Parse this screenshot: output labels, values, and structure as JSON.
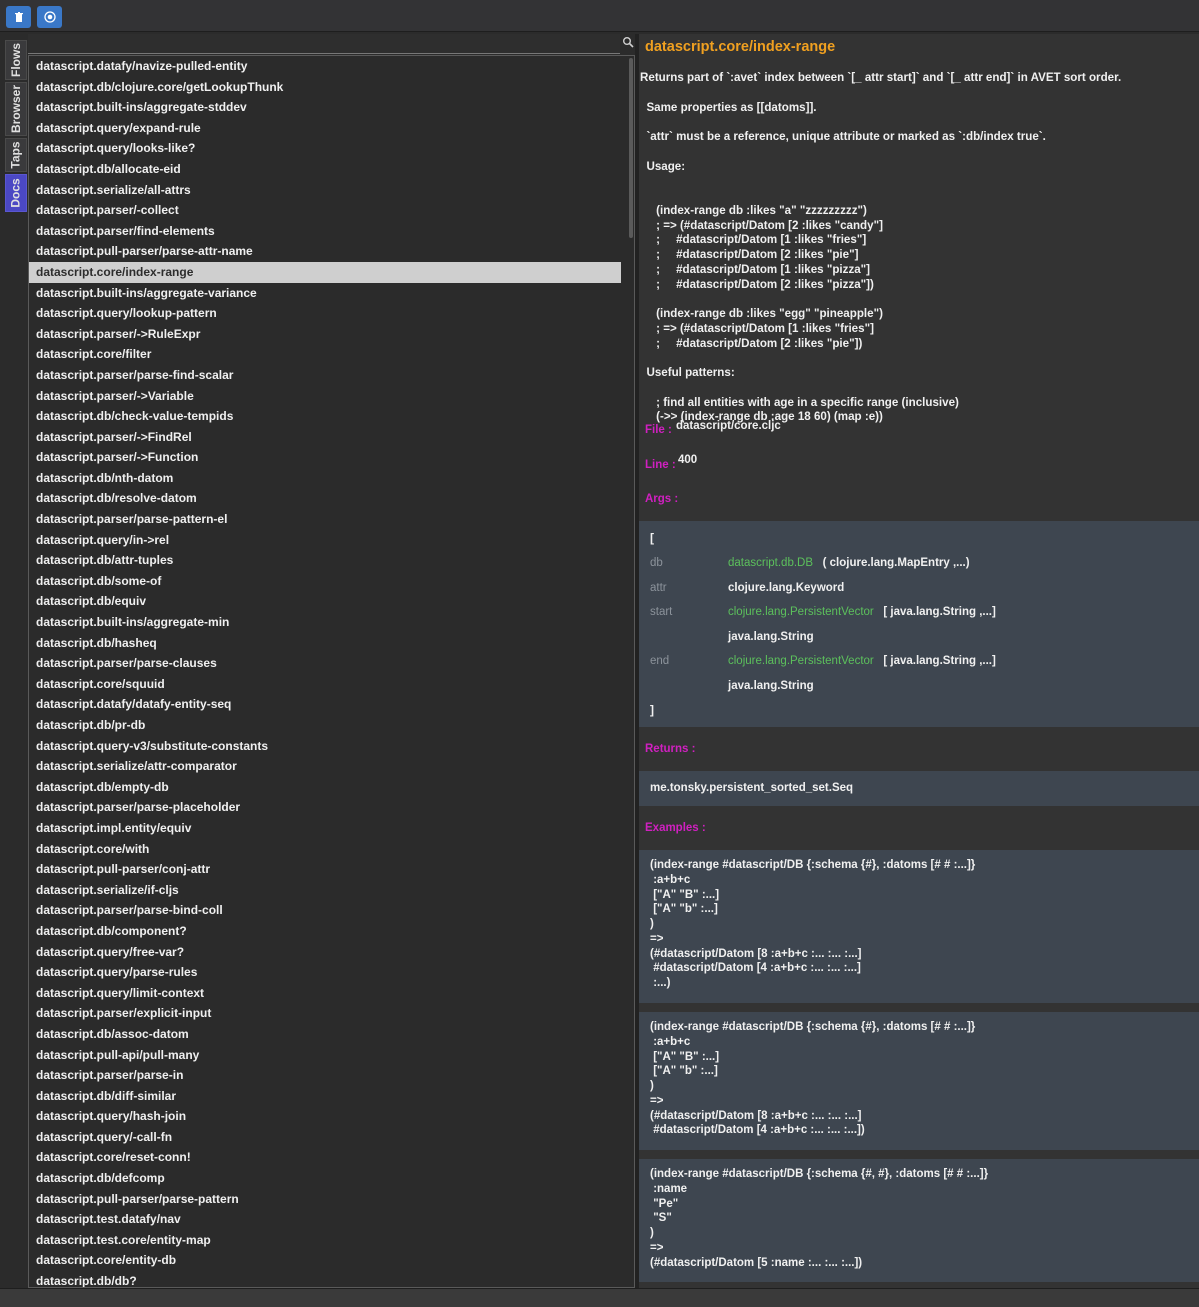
{
  "toolbar": {
    "buttons": [
      {
        "icon": "trash-icon"
      },
      {
        "icon": "record-icon"
      }
    ]
  },
  "tabs": [
    {
      "label": "Flows",
      "active": false
    },
    {
      "label": "Browser",
      "active": false
    },
    {
      "label": "Taps",
      "active": false
    },
    {
      "label": "Docs",
      "active": true
    }
  ],
  "search": {
    "value": "",
    "placeholder": ""
  },
  "list": {
    "selected_index": 10,
    "items": [
      "datascript.datafy/navize-pulled-entity",
      "datascript.db/clojure.core/getLookupThunk",
      "datascript.built-ins/aggregate-stddev",
      "datascript.query/expand-rule",
      "datascript.query/looks-like?",
      "datascript.db/allocate-eid",
      "datascript.serialize/all-attrs",
      "datascript.parser/-collect",
      "datascript.parser/find-elements",
      "datascript.pull-parser/parse-attr-name",
      "datascript.core/index-range",
      "datascript.built-ins/aggregate-variance",
      "datascript.query/lookup-pattern",
      "datascript.parser/->RuleExpr",
      "datascript.core/filter",
      "datascript.parser/parse-find-scalar",
      "datascript.parser/->Variable",
      "datascript.db/check-value-tempids",
      "datascript.parser/->FindRel",
      "datascript.parser/->Function",
      "datascript.db/nth-datom",
      "datascript.db/resolve-datom",
      "datascript.parser/parse-pattern-el",
      "datascript.query/in->rel",
      "datascript.db/attr-tuples",
      "datascript.db/some-of",
      "datascript.db/equiv",
      "datascript.built-ins/aggregate-min",
      "datascript.db/hasheq",
      "datascript.parser/parse-clauses",
      "datascript.core/squuid",
      "datascript.datafy/datafy-entity-seq",
      "datascript.db/pr-db",
      "datascript.query-v3/substitute-constants",
      "datascript.serialize/attr-comparator",
      "datascript.db/empty-db",
      "datascript.parser/parse-placeholder",
      "datascript.impl.entity/equiv",
      "datascript.core/with",
      "datascript.pull-parser/conj-attr",
      "datascript.serialize/if-cljs",
      "datascript.parser/parse-bind-coll",
      "datascript.db/component?",
      "datascript.query/free-var?",
      "datascript.query/parse-rules",
      "datascript.query/limit-context",
      "datascript.parser/explicit-input",
      "datascript.db/assoc-datom",
      "datascript.pull-api/pull-many",
      "datascript.parser/parse-in",
      "datascript.db/diff-similar",
      "datascript.query/hash-join",
      "datascript.query/-call-fn",
      "datascript.core/reset-conn!",
      "datascript.db/defcomp",
      "datascript.pull-parser/parse-pattern",
      "datascript.test.datafy/nav",
      "datascript.test.core/entity-map",
      "datascript.core/entity-db",
      "datascript.db/db?"
    ]
  },
  "doc": {
    "title": "datascript.core/index-range",
    "lines": [
      "Returns part of `:avet` index between `[_ attr start]` and `[_ attr end]` in AVET sort order.",
      "",
      "  Same properties as [[datoms]].",
      "",
      "  `attr` must be a reference, unique attribute or marked as `:db/index true`.",
      "",
      "  Usage:",
      "",
      "",
      "     (index-range db :likes \"a\" \"zzzzzzzzz\")",
      "     ; => (#datascript/Datom [2 :likes \"candy\"]",
      "     ;     #datascript/Datom [1 :likes \"fries\"]",
      "     ;     #datascript/Datom [2 :likes \"pie\"]",
      "     ;     #datascript/Datom [1 :likes \"pizza\"]",
      "     ;     #datascript/Datom [2 :likes \"pizza\"])",
      "",
      "     (index-range db :likes \"egg\" \"pineapple\")",
      "     ; => (#datascript/Datom [1 :likes \"fries\"]",
      "     ;     #datascript/Datom [2 :likes \"pie\"])",
      "",
      "  Useful patterns:",
      "",
      "     ; find all entities with age in a specific range (inclusive)",
      "     (->> (index-range db :age 18 60) (map :e))"
    ],
    "file_label": "File :",
    "file_value": "datascript/core.cljc",
    "line_label": "Line :",
    "line_value": "400",
    "args_label": "Args :",
    "args_open": "[",
    "args_close": "]",
    "args": [
      {
        "name": "db",
        "type_link": "datascript.db.DB",
        "type_extra": "( clojure.lang.MapEntry ,...)"
      },
      {
        "name": "attr",
        "type_link": "",
        "type_extra": "clojure.lang.Keyword"
      },
      {
        "name": "start",
        "type_link": "clojure.lang.PersistentVector",
        "type_extra": "[ java.lang.String ,...]"
      },
      {
        "name": "",
        "type_link": "",
        "type_extra": "java.lang.String"
      },
      {
        "name": "end",
        "type_link": "clojure.lang.PersistentVector",
        "type_extra": "[ java.lang.String ,...]"
      },
      {
        "name": "",
        "type_link": "",
        "type_extra": "java.lang.String"
      }
    ],
    "returns_label": "Returns :",
    "returns_value": "me.tonsky.persistent_sorted_set.Seq",
    "examples_label": "Examples :",
    "examples": [
      [
        "(index-range #datascript/DB {:schema {#}, :datoms [# # :...]}",
        " :a+b+c",
        " [\"A\" \"B\" :...]",
        " [\"A\" \"b\" :...]",
        ")",
        "=>",
        "(#datascript/Datom [8 :a+b+c :... :... :...]",
        " #datascript/Datom [4 :a+b+c :... :... :...]",
        " :...)"
      ],
      [
        "(index-range #datascript/DB {:schema {#}, :datoms [# # :...]}",
        " :a+b+c",
        " [\"A\" \"B\" :...]",
        " [\"A\" \"b\" :...]",
        ")",
        "=>",
        "(#datascript/Datom [8 :a+b+c :... :... :...]",
        " #datascript/Datom [4 :a+b+c :... :... :...])"
      ],
      [
        "(index-range #datascript/DB {:schema {#, #}, :datoms [# # :...]}",
        " :name",
        " \"Pe\"",
        " \"S\"",
        ")",
        "=>",
        "(#datascript/Datom [5 :name :... :... :...])"
      ]
    ]
  }
}
